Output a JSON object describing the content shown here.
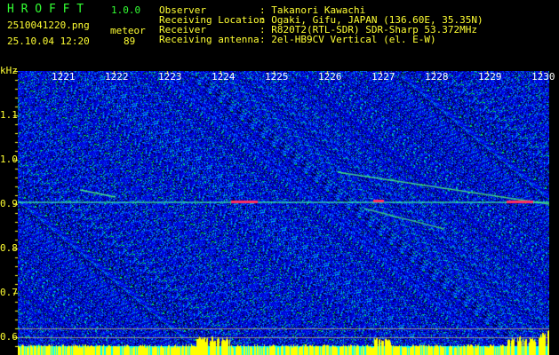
{
  "app": {
    "name": "H R O F F T",
    "version": "1.0.0"
  },
  "file": {
    "name": "2510041220.png",
    "datetime": "25.10.04 12:20"
  },
  "counter": {
    "label": "meteor",
    "value": "89"
  },
  "info": [
    {
      "label": "Observer",
      "value": ": Takanori Kawachi"
    },
    {
      "label": "Receiving Location",
      "value": ": Ogaki, Gifu, JAPAN (136.60E, 35.35N)"
    },
    {
      "label": "Receiver",
      "value": ": R820T2(RTL-SDR) SDR-Sharp 53.372MHz"
    },
    {
      "label": "Receiving antenna",
      "value": ": 2el-HB9CV Vertical (el. E-W)"
    }
  ],
  "axis": {
    "y_unit": "kHz",
    "y_ticks": [
      "1.1",
      "1.0",
      "0.9",
      "0.8",
      "0.7",
      "0.6"
    ],
    "x_ticks": [
      "1221",
      "1222",
      "1223",
      "1224",
      "1225",
      "1226",
      "1227",
      "1228",
      "1229",
      "1230"
    ]
  },
  "colors": {
    "text": "#ffff33",
    "title": "#33ff33",
    "background": "#000000",
    "noise": "#0000c0",
    "power": "#ffff00",
    "base": "#00ffff"
  }
}
